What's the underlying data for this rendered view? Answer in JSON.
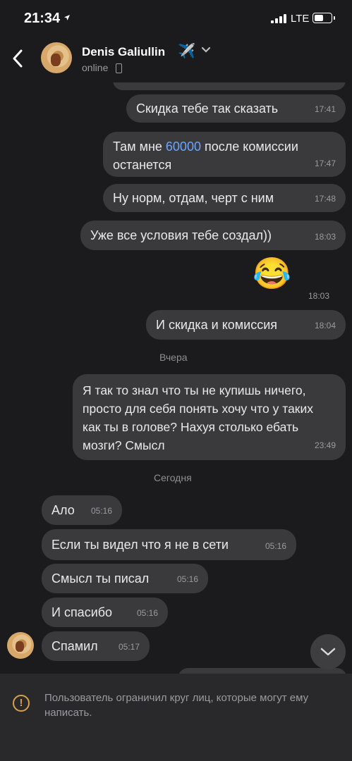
{
  "status_bar": {
    "time": "21:34",
    "location_icon": "location-arrow-icon",
    "network": "LTE",
    "signal_bars": 4
  },
  "header": {
    "contact_name": "Denis Galiullin",
    "name_emoji": "✈️",
    "status": "online",
    "status_icon": "mobile-phone-icon"
  },
  "messages": [
    {
      "text": "Скидка тебе так сказать",
      "time": "17:41",
      "side": "out"
    },
    {
      "text_before": "Там мне ",
      "link": "60000",
      "text_after": " после комиссии останется",
      "time": "17:47",
      "side": "out"
    },
    {
      "text": "Ну норм, отдам, черт с ним",
      "time": "17:48",
      "side": "out"
    },
    {
      "text": "Уже все условия тебе создал))",
      "time": "18:03",
      "side": "out"
    },
    {
      "emoji": "😂",
      "time": "18:03",
      "side": "out"
    },
    {
      "text": "И скидка и комиссия",
      "time": "18:04",
      "side": "out"
    },
    {
      "text": "Я так то знал что ты не купишь ничего, просто для себя понять хочу что у таких как ты в голове? Нахуя столько ебать мозги? Смысл",
      "time": "23:49",
      "side": "out"
    },
    {
      "text": "Ало",
      "time": "05:16",
      "side": "in"
    },
    {
      "text": "Если ты видел что я не в сети",
      "time": "05:16",
      "side": "in"
    },
    {
      "text": "Смысл ты писал",
      "time": "05:16",
      "side": "in"
    },
    {
      "text": "И спасибо",
      "time": "05:16",
      "side": "in"
    },
    {
      "text": "Спамил",
      "time": "05:17",
      "side": "in"
    }
  ],
  "dates": {
    "yesterday": "Вчера",
    "today": "Сегодня"
  },
  "notice": {
    "text": "Пользователь ограничил круг лиц, которые могут ему написать.",
    "icon": "warning-icon"
  },
  "colors": {
    "background": "#1b1b1d",
    "bubble": "#3a3a3c",
    "link": "#6aa6ff",
    "warning": "#d7a24a"
  }
}
